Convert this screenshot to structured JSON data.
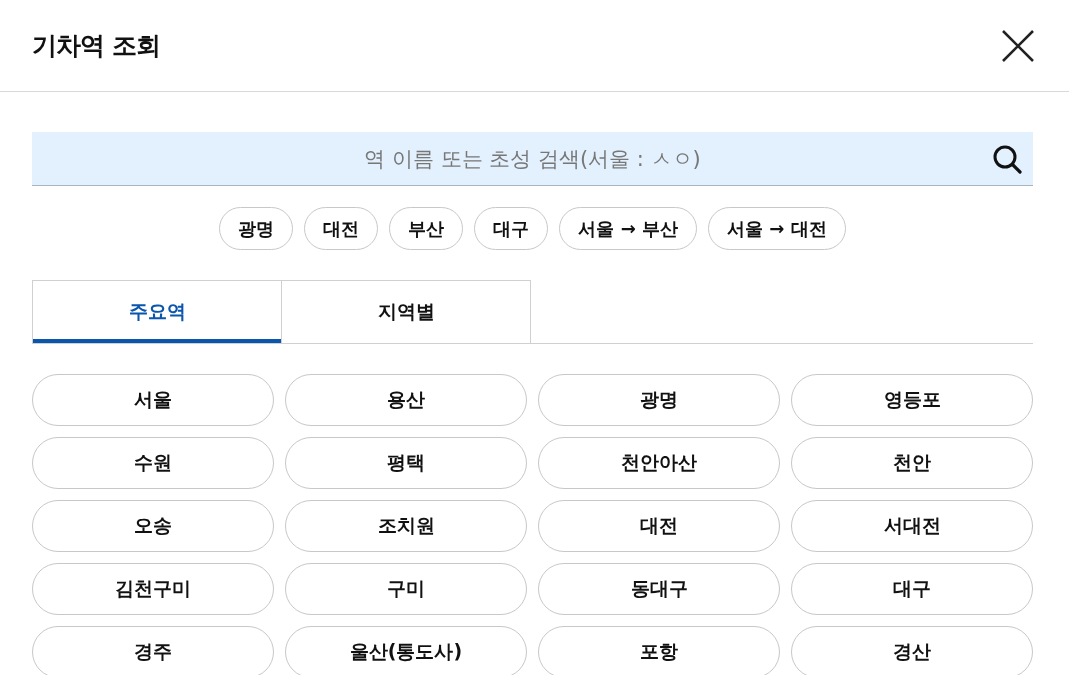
{
  "window": {
    "title": "기차역 조회"
  },
  "search": {
    "placeholder": "역 이름 또는 초성 검색(서울 : ㅅㅇ)"
  },
  "quick_chips": [
    "광명",
    "대전",
    "부산",
    "대구",
    "서울 → 부산",
    "서울 → 대전"
  ],
  "tabs": [
    {
      "label": "주요역",
      "selected": true
    },
    {
      "label": "지역별",
      "selected": false
    }
  ],
  "stations": [
    "서울",
    "용산",
    "광명",
    "영등포",
    "수원",
    "평택",
    "천안아산",
    "천안",
    "오송",
    "조치원",
    "대전",
    "서대전",
    "김천구미",
    "구미",
    "동대구",
    "대구",
    "경주",
    "울산(통도사)",
    "포항",
    "경산"
  ]
}
